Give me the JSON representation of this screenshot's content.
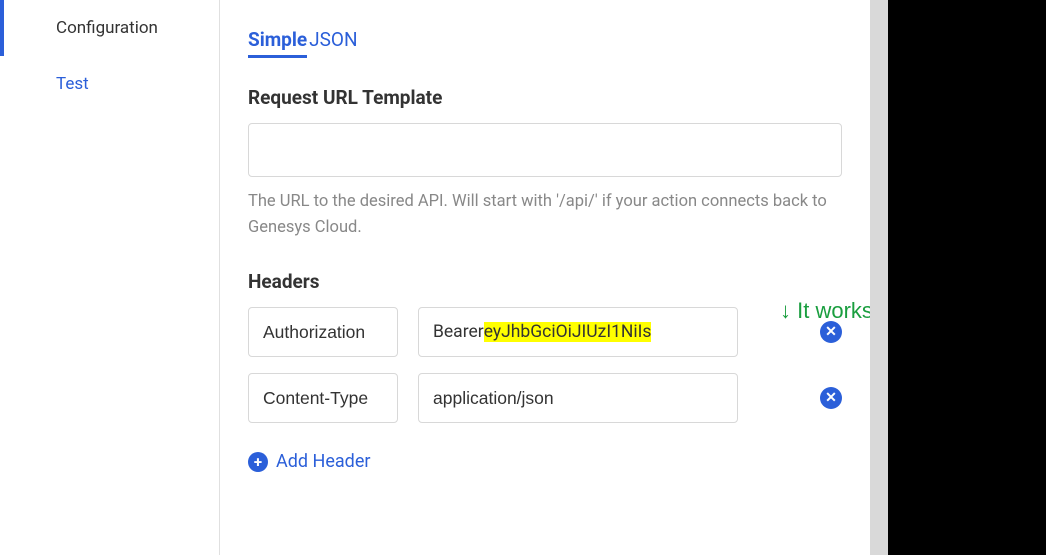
{
  "sidebar": {
    "items": [
      {
        "label": "Configuration"
      },
      {
        "label": "Test"
      }
    ]
  },
  "tabs": {
    "simple": "Simple",
    "json": "JSON"
  },
  "url_section": {
    "label": "Request URL Template",
    "value": "",
    "helper": "The URL to the desired API. Will start with '/api/' if your action connects back to Genesys Cloud."
  },
  "headers_section": {
    "label": "Headers",
    "rows": [
      {
        "key": "Authorization",
        "prefix": "Bearer ",
        "token": "eyJhbGciOiJIUzI1NiIs"
      },
      {
        "key": "Content-Type",
        "value": "application/json"
      }
    ],
    "add_label": "Add Header"
  },
  "annotation": {
    "text": "↓ It works when paste here."
  }
}
